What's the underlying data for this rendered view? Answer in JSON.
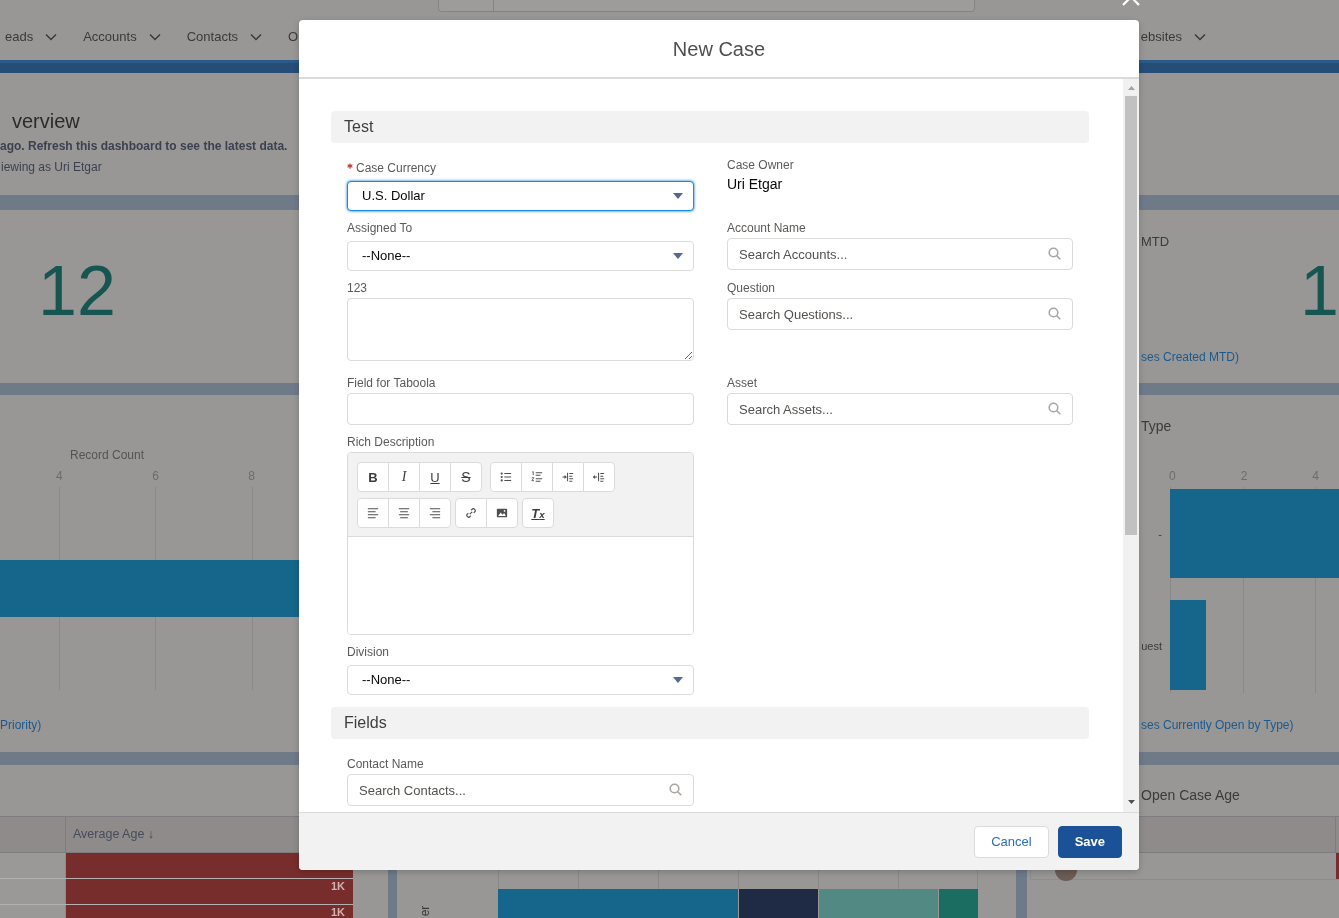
{
  "global_nav": {
    "left_tabs": [
      {
        "label": "eads",
        "has_menu": true
      },
      {
        "label": "Accounts",
        "has_menu": true
      },
      {
        "label": "Contacts",
        "has_menu": true
      },
      {
        "label": "O",
        "has_menu": false
      }
    ],
    "right_tabs": [
      {
        "label": "ebsites",
        "has_menu": true
      }
    ]
  },
  "dashboard": {
    "title": "verview",
    "refresh_note": "ago. Refresh this dashboard to see the latest data.",
    "viewing_as": "iewing as Uri Etgar"
  },
  "metric_left": {
    "value": "12"
  },
  "metric_right": {
    "title": "MTD",
    "value": "1",
    "link": "ses Created MTD)"
  },
  "chart_left": {
    "axis_title": "Record Count",
    "ticks": [
      "4",
      "6",
      "8"
    ],
    "link": "Priority)"
  },
  "chart_right": {
    "title": "Type",
    "ticks": [
      "0",
      "2",
      "4"
    ],
    "categories": [
      "-",
      "uest"
    ],
    "link": "ses Currently Open by Type)"
  },
  "table_left": {
    "column": "Average Age ↓",
    "rows": [
      {
        "kind": "blank"
      },
      {
        "kind": "value",
        "value": "1K"
      },
      {
        "kind": "value",
        "value": "1K"
      }
    ]
  },
  "chart_bottom": {
    "axis_label": "er"
  },
  "table_right": {
    "title": "Open Case Age"
  },
  "modal": {
    "title": "New Case",
    "sections": [
      {
        "title": "Test",
        "rows": [
          [
            {
              "kind": "picklist",
              "label": "Case Currency",
              "required": true,
              "focused": true,
              "value": "U.S. Dollar"
            },
            {
              "kind": "readonly",
              "label": "Case Owner",
              "required": false,
              "value": "Uri Etgar"
            }
          ],
          [
            {
              "kind": "picklist",
              "label": "Assigned To",
              "required": false,
              "focused": false,
              "value": "--None--"
            },
            {
              "kind": "lookup",
              "label": "Account Name",
              "required": false,
              "focused": false,
              "placeholder": "Search Accounts..."
            }
          ],
          [
            {
              "kind": "textarea",
              "label": "123",
              "required": false,
              "focused": false
            },
            {
              "kind": "lookup",
              "label": "Question",
              "required": false,
              "focused": false,
              "placeholder": "Search Questions..."
            }
          ],
          [
            {
              "kind": "text",
              "label": "Field for Taboola",
              "required": false,
              "focused": false
            },
            {
              "kind": "lookup",
              "label": "Asset",
              "required": false,
              "focused": false,
              "placeholder": "Search Assets..."
            }
          ],
          [
            {
              "kind": "richtext",
              "label": "Rich Description",
              "required": false,
              "focused": false,
              "toolbar": [
                [
                  [
                    {
                      "kind": "bold",
                      "label": "B"
                    },
                    {
                      "kind": "italic",
                      "label": "I"
                    },
                    {
                      "kind": "underline",
                      "label": "U"
                    },
                    {
                      "kind": "strike",
                      "label": "S"
                    }
                  ],
                  [
                    {
                      "kind": "bullets"
                    },
                    {
                      "kind": "numbers"
                    },
                    {
                      "kind": "indent"
                    },
                    {
                      "kind": "outdent"
                    }
                  ]
                ],
                [
                  [
                    {
                      "kind": "left"
                    },
                    {
                      "kind": "center"
                    },
                    {
                      "kind": "right"
                    }
                  ],
                  [
                    {
                      "kind": "link"
                    },
                    {
                      "kind": "image"
                    }
                  ],
                  [
                    {
                      "kind": "clear",
                      "label": "T$_{x}$"
                    }
                  ]
                ]
              ]
            }
          ],
          [
            {
              "kind": "picklist",
              "label": "Division",
              "required": false,
              "focused": false,
              "value": "--None--"
            }
          ]
        ]
      },
      {
        "title": "Fields",
        "rows": [
          [
            {
              "kind": "lookup",
              "label": "Contact Name",
              "required": false,
              "focused": false,
              "placeholder": "Search Contacts..."
            }
          ]
        ]
      }
    ],
    "buttons": [
      {
        "kind": "neutral",
        "label": "Cancel"
      },
      {
        "kind": "brand",
        "label": "Save"
      }
    ]
  }
}
